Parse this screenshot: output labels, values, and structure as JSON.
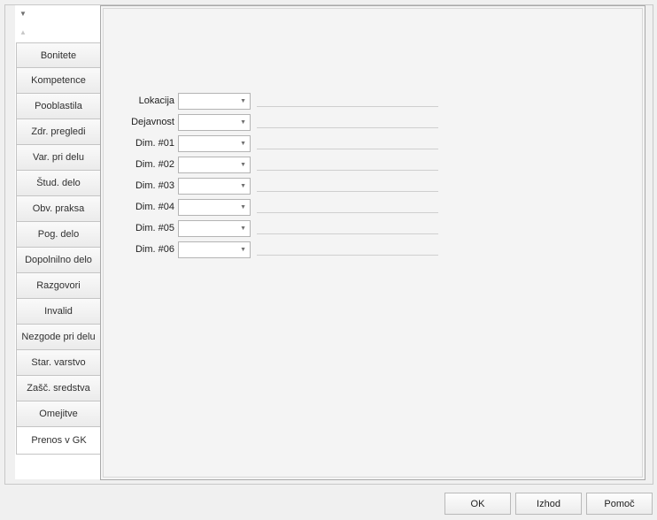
{
  "tabs": [
    {
      "label": "Bonitete"
    },
    {
      "label": "Kompetence"
    },
    {
      "label": "Pooblastila"
    },
    {
      "label": "Zdr. pregledi"
    },
    {
      "label": "Var. pri delu"
    },
    {
      "label": "Štud. delo"
    },
    {
      "label": "Obv. praksa"
    },
    {
      "label": "Pog. delo"
    },
    {
      "label": "Dopolnilno delo"
    },
    {
      "label": "Razgovori"
    },
    {
      "label": "Invalid"
    },
    {
      "label": "Nezgode pri delu"
    },
    {
      "label": "Star. varstvo"
    },
    {
      "label": "Zašč. sredstva"
    },
    {
      "label": "Omejitve"
    },
    {
      "label": "Prenos v GK"
    }
  ],
  "active_tab": "Prenos v GK",
  "fields": [
    {
      "label": "Lokacija",
      "value": ""
    },
    {
      "label": "Dejavnost",
      "value": ""
    },
    {
      "label": "Dim. #01",
      "value": ""
    },
    {
      "label": "Dim. #02",
      "value": ""
    },
    {
      "label": "Dim. #03",
      "value": ""
    },
    {
      "label": "Dim. #04",
      "value": ""
    },
    {
      "label": "Dim. #05",
      "value": ""
    },
    {
      "label": "Dim. #06",
      "value": ""
    }
  ],
  "buttons": {
    "ok": "OK",
    "exit": "Izhod",
    "help": "Pomoč"
  },
  "icons": {
    "scroll_down": "▼",
    "scroll_up": "▲",
    "dropdown": "▼"
  }
}
